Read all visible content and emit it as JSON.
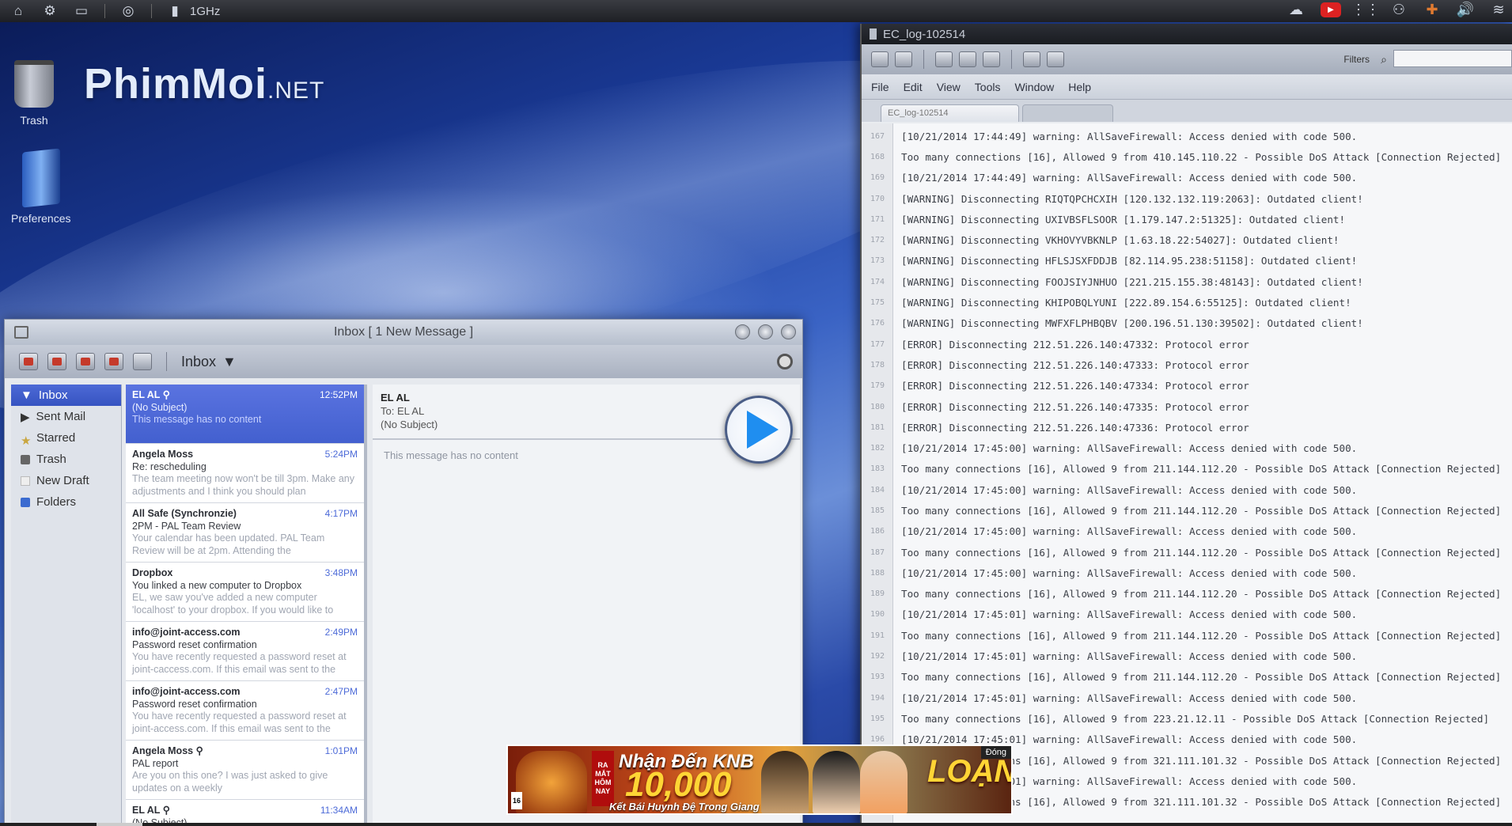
{
  "topbar": {
    "clock": "1GHz"
  },
  "desktop": {
    "logo_main": "PhimMoi",
    "logo_suffix": ".NET",
    "icons": [
      {
        "label": "Trash"
      },
      {
        "label": "Preferences"
      }
    ]
  },
  "mail": {
    "window_title": "Inbox [ 1 New Message ]",
    "toolbar_dropdown": "Inbox",
    "folders": [
      {
        "label": "Inbox",
        "icon": "triangle-down"
      },
      {
        "label": "Sent Mail",
        "icon": "triangle-right"
      },
      {
        "label": "Starred",
        "icon": "star"
      },
      {
        "label": "Trash",
        "icon": "trash"
      },
      {
        "label": "New Draft",
        "icon": "draft"
      },
      {
        "label": "Folders",
        "icon": "folder"
      }
    ],
    "messages": [
      {
        "from": "EL AL",
        "time": "12:52PM",
        "subject": "(No Subject)",
        "preview": "This message has no content"
      },
      {
        "from": "Angela Moss",
        "time": "5:24PM",
        "subject": "Re: rescheduling",
        "preview": "The team meeting now won't be till 3pm. Make any adjustments and I think you should plan"
      },
      {
        "from": "All Safe (Synchronzie)",
        "time": "4:17PM",
        "subject": "2PM - PAL Team Review",
        "preview": "Your calendar has been updated. PAL Team Review will be at 2pm. Attending the"
      },
      {
        "from": "Dropbox",
        "time": "3:48PM",
        "subject": "You linked a new computer to Dropbox",
        "preview": "EL, we saw you've added a new computer 'localhost' to your dropbox. If you would like to"
      },
      {
        "from": "info@joint-access.com",
        "time": "2:49PM",
        "subject": "Password reset confirmation",
        "preview": "You have recently requested a password reset at joint-caccess.com. If this email was sent to the"
      },
      {
        "from": "info@joint-access.com",
        "time": "2:47PM",
        "subject": "Password reset confirmation",
        "preview": "You have recently requested a password reset at joint-access.com. If this email was sent to the"
      },
      {
        "from": "Angela Moss",
        "time": "1:01PM",
        "subject": "PAL report",
        "preview": "Are you on this one? I was just asked to give updates on a weekly"
      },
      {
        "from": "EL AL",
        "time": "11:34AM",
        "subject": "(No Subject)",
        "preview": ""
      }
    ],
    "reading": {
      "from": "EL AL",
      "to": "To: EL AL",
      "subject": "(No Subject)",
      "body": "This message has no content"
    }
  },
  "log": {
    "window_title": "EC_log-102514",
    "filter_label": "Filters",
    "menu": [
      "File",
      "Edit",
      "View",
      "Tools",
      "Window",
      "Help"
    ],
    "tabs": [
      "EC_log-102514",
      ""
    ],
    "lines": [
      {
        "n": "167",
        "t": "[10/21/2014 17:44:49] warning: AllSaveFirewall: Access denied with code 500."
      },
      {
        "n": "168",
        "t": "Too many connections [16], Allowed 9 from 410.145.110.22 - Possible DoS Attack [Connection Rejected]"
      },
      {
        "n": "169",
        "t": "[10/21/2014 17:44:49] warning: AllSaveFirewall: Access denied with code 500."
      },
      {
        "n": "170",
        "t": "[WARNING] Disconnecting RIQTQPCHCXIH [120.132.132.119:2063]: Outdated client!"
      },
      {
        "n": "171",
        "t": "[WARNING] Disconnecting UXIVBSFLSOOR [1.179.147.2:51325]: Outdated client!"
      },
      {
        "n": "172",
        "t": "[WARNING] Disconnecting VKHOVYVBKNLP [1.63.18.22:54027]: Outdated client!"
      },
      {
        "n": "173",
        "t": "[WARNING] Disconnecting HFLSJSXFDDJB [82.114.95.238:51158]: Outdated client!"
      },
      {
        "n": "174",
        "t": "[WARNING] Disconnecting FOOJSIYJNHUO [221.215.155.38:48143]: Outdated client!"
      },
      {
        "n": "175",
        "t": "[WARNING] Disconnecting KHIPOBQLYUNI [222.89.154.6:55125]: Outdated client!"
      },
      {
        "n": "176",
        "t": "[WARNING] Disconnecting MWFXFLPHBQBV [200.196.51.130:39502]: Outdated client!"
      },
      {
        "n": "177",
        "t": "[ERROR] Disconnecting 212.51.226.140:47332: Protocol error"
      },
      {
        "n": "178",
        "t": "[ERROR] Disconnecting 212.51.226.140:47333: Protocol error"
      },
      {
        "n": "179",
        "t": "[ERROR] Disconnecting 212.51.226.140:47334: Protocol error"
      },
      {
        "n": "180",
        "t": "[ERROR] Disconnecting 212.51.226.140:47335: Protocol error"
      },
      {
        "n": "181",
        "t": "[ERROR] Disconnecting 212.51.226.140:47336: Protocol error"
      },
      {
        "n": "182",
        "t": "[10/21/2014 17:45:00] warning: AllSaveFirewall: Access denied with code 500."
      },
      {
        "n": "183",
        "t": "Too many connections [16], Allowed 9 from 211.144.112.20 - Possible DoS Attack [Connection Rejected]"
      },
      {
        "n": "184",
        "t": "[10/21/2014 17:45:00] warning: AllSaveFirewall: Access denied with code 500."
      },
      {
        "n": "185",
        "t": "Too many connections [16], Allowed 9 from 211.144.112.20 - Possible DoS Attack [Connection Rejected]"
      },
      {
        "n": "186",
        "t": "[10/21/2014 17:45:00] warning: AllSaveFirewall: Access denied with code 500."
      },
      {
        "n": "187",
        "t": "Too many connections [16], Allowed 9 from 211.144.112.20 - Possible DoS Attack [Connection Rejected]"
      },
      {
        "n": "188",
        "t": "[10/21/2014 17:45:00] warning: AllSaveFirewall: Access denied with code 500."
      },
      {
        "n": "189",
        "t": "Too many connections [16], Allowed 9 from 211.144.112.20 - Possible DoS Attack [Connection Rejected]"
      },
      {
        "n": "190",
        "t": "[10/21/2014 17:45:01] warning: AllSaveFirewall: Access denied with code 500."
      },
      {
        "n": "191",
        "t": "Too many connections [16], Allowed 9 from 211.144.112.20 - Possible DoS Attack [Connection Rejected]"
      },
      {
        "n": "192",
        "t": "[10/21/2014 17:45:01] warning: AllSaveFirewall: Access denied with code 500."
      },
      {
        "n": "193",
        "t": "Too many connections [16], Allowed 9 from 211.144.112.20 - Possible DoS Attack [Connection Rejected]"
      },
      {
        "n": "194",
        "t": "[10/21/2014 17:45:01] warning: AllSaveFirewall: Access denied with code 500."
      },
      {
        "n": "195",
        "t": "Too many connections [16], Allowed 9 from 223.21.12.11 - Possible DoS Attack [Connection Rejected]"
      },
      {
        "n": "196",
        "t": "[10/21/2014 17:45:01] warning: AllSaveFirewall: Access denied with code 500."
      },
      {
        "n": "197",
        "t": "Too many connections [16], Allowed 9 from 321.111.101.32 - Possible DoS Attack [Connection Rejected]"
      },
      {
        "n": "198",
        "t": "[10/21/2014 17:45:01] warning: AllSaveFirewall: Access denied with code 500."
      },
      {
        "n": "199",
        "t": "Too many connections [16], Allowed 9 from 321.111.101.32 - Possible DoS Attack [Connection Rejected]"
      }
    ]
  },
  "banner": {
    "badge": "RA MẮT HÔM NAY",
    "headline": "Nhận Đến KNB",
    "amount": "10,000",
    "tagline": "Kết Bái Huynh Đệ Trong Giang Hồ",
    "game": "LOẠN",
    "close_label": "Đóng",
    "age": "16"
  }
}
